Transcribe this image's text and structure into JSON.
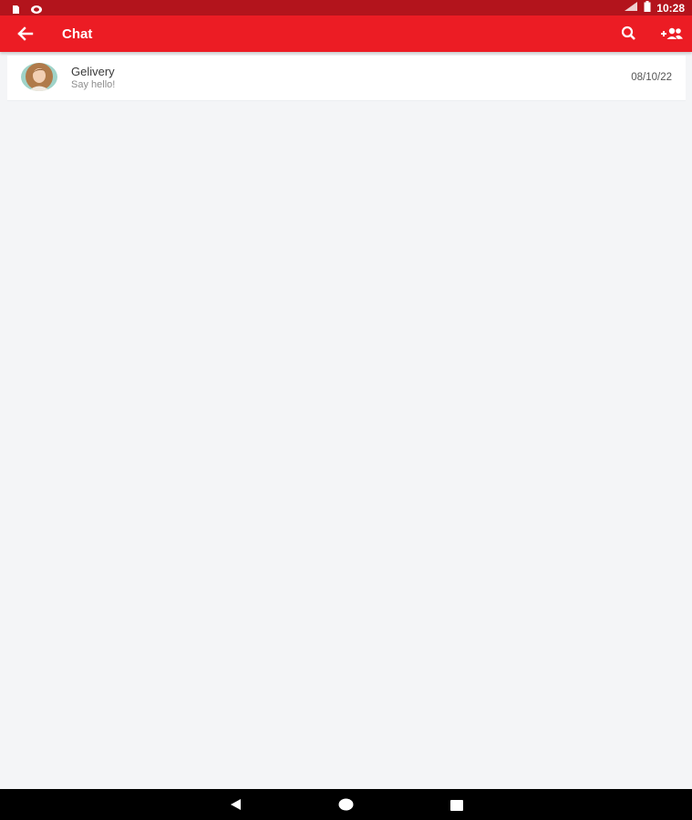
{
  "status_bar": {
    "time": "10:28",
    "icons": [
      "sim-card-icon",
      "notification-icon",
      "signal-icon",
      "battery-icon"
    ]
  },
  "app_bar": {
    "title": "Chat",
    "background": "#ec1c24",
    "icons": [
      "back-arrow-icon",
      "search-icon",
      "add-group-icon"
    ]
  },
  "chats": [
    {
      "name": "Gelivery",
      "preview": "Say hello!",
      "date": "08/10/22",
      "avatar_icon": "user-avatar"
    }
  ],
  "nav_bar": {
    "icons": [
      "nav-back-icon",
      "nav-home-icon",
      "nav-recents-icon"
    ]
  }
}
